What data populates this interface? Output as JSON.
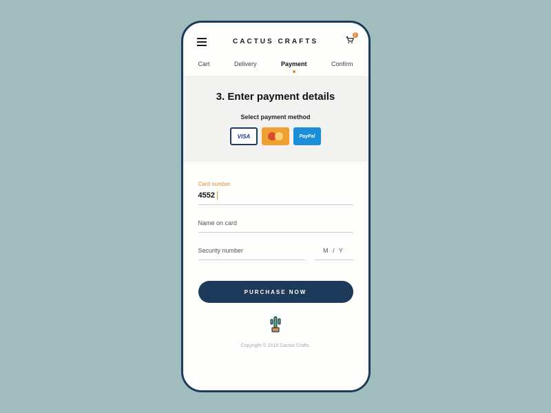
{
  "header": {
    "brand": "CACTUS CRAFTS",
    "cart_count": "1"
  },
  "steps": {
    "items": [
      "Cart",
      "Delivery",
      "Payment",
      "Confirm"
    ],
    "active_index": 2
  },
  "panel": {
    "title": "3. Enter payment details",
    "subtitle": "Select payment method",
    "methods": {
      "visa": "VISA",
      "paypal": "PayPal"
    }
  },
  "form": {
    "card_number": {
      "label": "Card number",
      "value": "4552"
    },
    "name": {
      "label": "Name on card"
    },
    "security": {
      "label": "Security number"
    },
    "expiry": {
      "month": "M",
      "sep": "/",
      "year": "Y"
    }
  },
  "cta": {
    "purchase": "PURCHASE NOW"
  },
  "footer": {
    "copyright": "Copyright © 2018 Cactus Crafts."
  }
}
